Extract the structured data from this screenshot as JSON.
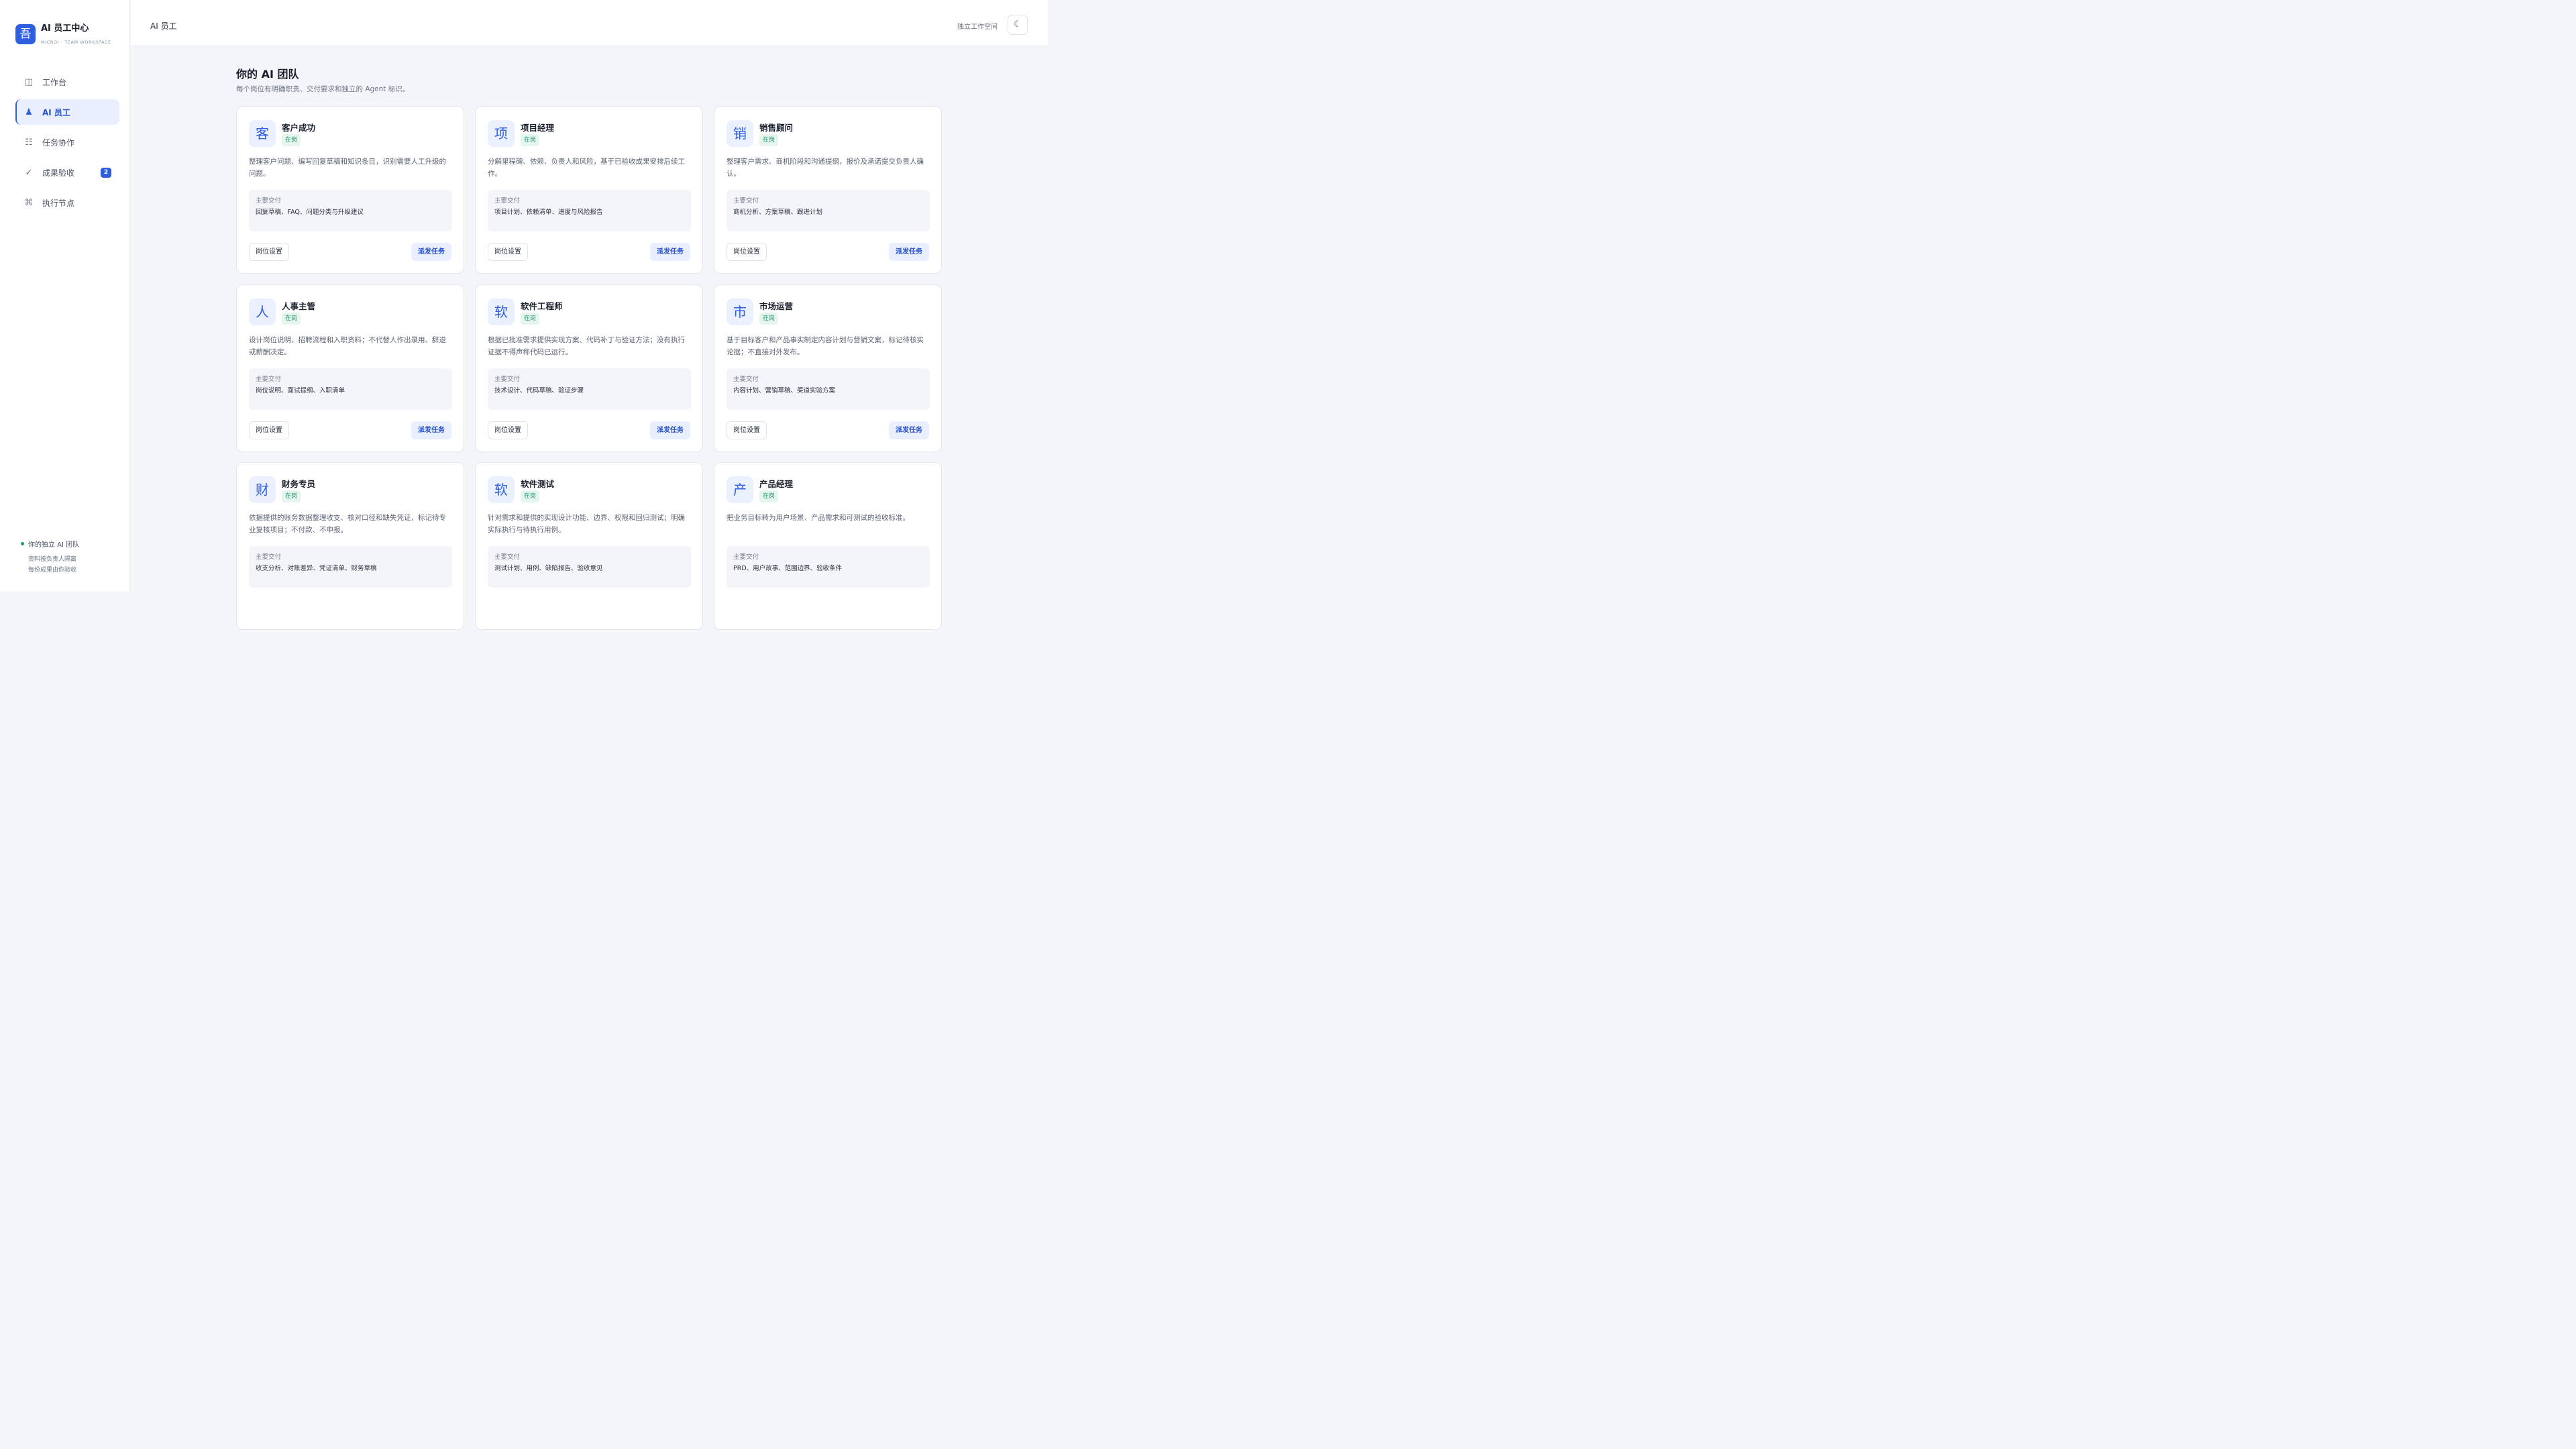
{
  "brand": {
    "logo_char": "吾",
    "name": "AI 员工中心",
    "subtitle": "MICROI · TEAM WORKSPACE"
  },
  "nav": [
    {
      "label": "工作台",
      "icon": "◫",
      "active": false
    },
    {
      "label": "AI 员工",
      "icon": "♟",
      "active": true
    },
    {
      "label": "任务协作",
      "icon": "☷",
      "active": false
    },
    {
      "label": "成果验收",
      "icon": "✓",
      "active": false,
      "badge": "2"
    },
    {
      "label": "执行节点",
      "icon": "⌘",
      "active": false
    }
  ],
  "sidebar_footer": {
    "title": "你的独立 AI 团队",
    "line1": "资料按负责人隔离",
    "line2": "每份成果由你验收"
  },
  "header": {
    "title": "AI 员工",
    "workspace": "独立工作空间",
    "theme_icon": "☾"
  },
  "page": {
    "title": "你的 AI 团队",
    "subtitle": "每个岗位有明确职责、交付要求和独立的 Agent 标识。"
  },
  "labels": {
    "deliverables": "主要交付",
    "settings": "岗位设置",
    "dispatch": "派发任务",
    "status_on": "在岗"
  },
  "cards": [
    {
      "avatar": "客",
      "name": "客户成功",
      "status": "在岗",
      "desc": "整理客户问题、编写回复草稿和知识条目，识别需要人工升级的问题。",
      "deliverables": "回复草稿、FAQ、问题分类与升级建议"
    },
    {
      "avatar": "项",
      "name": "项目经理",
      "status": "在岗",
      "desc": "分解里程碑、依赖、负责人和风险，基于已验收成果安排后续工作。",
      "deliverables": "项目计划、依赖清单、进度与风险报告"
    },
    {
      "avatar": "销",
      "name": "销售顾问",
      "status": "在岗",
      "desc": "整理客户需求、商机阶段和沟通提纲，报价及承诺提交负责人确认。",
      "deliverables": "商机分析、方案草稿、跟进计划"
    },
    {
      "avatar": "人",
      "name": "人事主管",
      "status": "在岗",
      "desc": "设计岗位说明、招聘流程和入职资料；不代替人作出录用、辞退或薪酬决定。",
      "deliverables": "岗位说明、面试提纲、入职清单"
    },
    {
      "avatar": "软",
      "name": "软件工程师",
      "status": "在岗",
      "desc": "根据已批准需求提供实现方案、代码补丁与验证方法；没有执行证据不得声称代码已运行。",
      "deliverables": "技术设计、代码草稿、验证步骤"
    },
    {
      "avatar": "市",
      "name": "市场运营",
      "status": "在岗",
      "desc": "基于目标客户和产品事实制定内容计划与营销文案，标记待核实论据；不直接对外发布。",
      "deliverables": "内容计划、营销草稿、渠道实验方案"
    },
    {
      "avatar": "财",
      "name": "财务专员",
      "status": "在岗",
      "desc": "依据提供的账务数据整理收支、核对口径和缺失凭证，标记待专业复核项目；不付款、不申报。",
      "deliverables": "收支分析、对账差异、凭证清单、财务草稿"
    },
    {
      "avatar": "软",
      "name": "软件测试",
      "status": "在岗",
      "desc": "针对需求和提供的实现设计功能、边界、权限和回归测试；明确实际执行与待执行用例。",
      "deliverables": "测试计划、用例、缺陷报告、验收意见"
    },
    {
      "avatar": "产",
      "name": "产品经理",
      "status": "在岗",
      "desc": "把业务目标转为用户场景、产品需求和可测试的验收标准。",
      "deliverables": "PRD、用户故事、范围边界、验收条件"
    }
  ]
}
